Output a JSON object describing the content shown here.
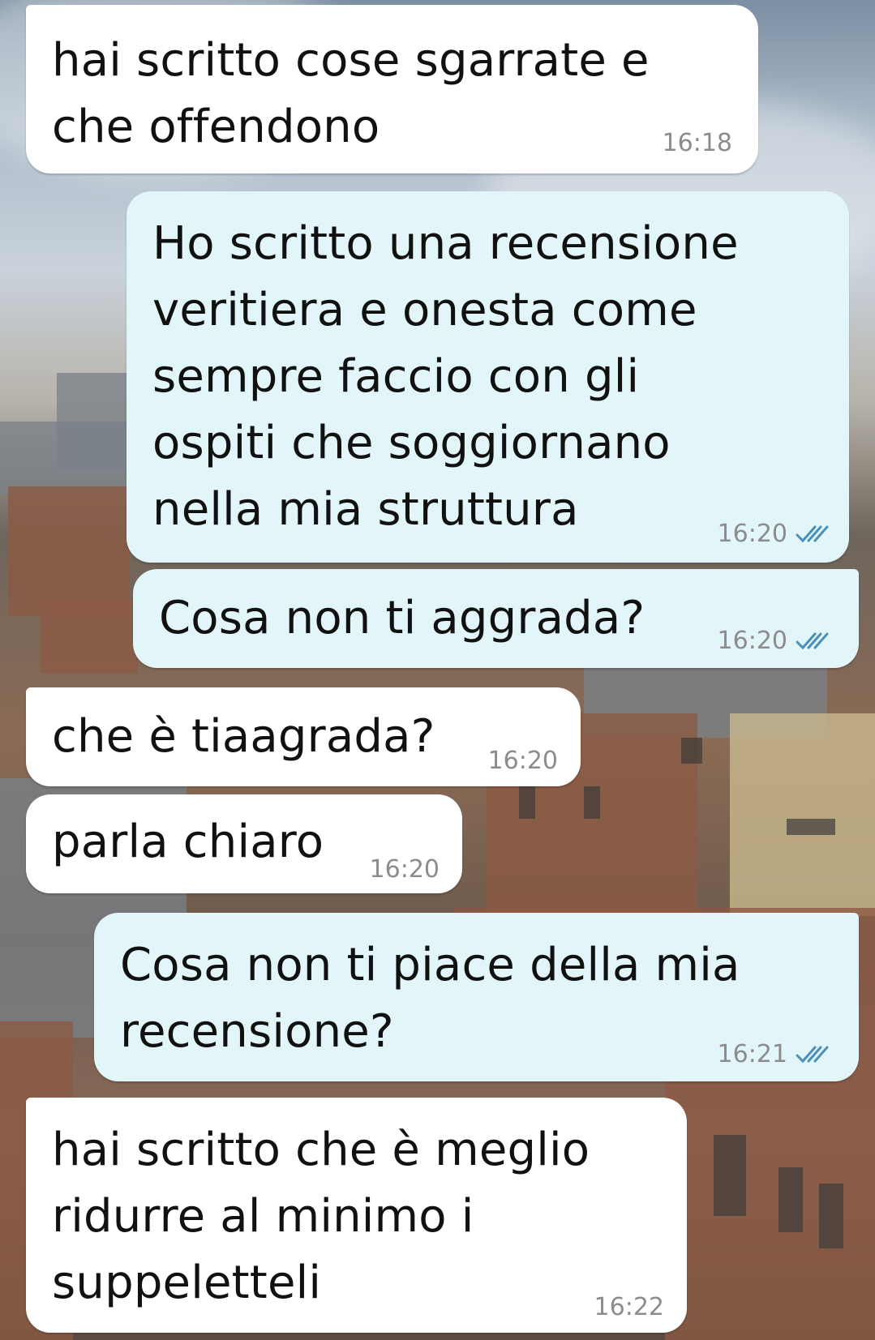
{
  "chat": {
    "messages": [
      {
        "direction": "in",
        "text": "hai scritto cose sgarrate e\nche offendono",
        "time": "16:18"
      },
      {
        "direction": "out",
        "text": "Ho scritto una recensione\nveritiera e onesta come\nsempre faccio con gli\nospiti che soggiornano\nnella mia struttura",
        "time": "16:20",
        "status_icon": "double-check-icon"
      },
      {
        "direction": "out",
        "text": "Cosa non ti aggrada?",
        "time": "16:20",
        "status_icon": "double-check-icon"
      },
      {
        "direction": "in",
        "text": "che è tiaagrada?",
        "time": "16:20"
      },
      {
        "direction": "in",
        "text": "parla chiaro",
        "time": "16:20"
      },
      {
        "direction": "out",
        "text": "Cosa non ti piace della mia\nrecensione?",
        "time": "16:21",
        "status_icon": "double-check-icon"
      },
      {
        "direction": "in",
        "text": "hai scritto che è meglio\nridurre al minimo i\nsuppeletteli",
        "time": "16:22"
      }
    ]
  },
  "colors": {
    "incoming_bubble": "#ffffff",
    "outgoing_bubble": "#e2f6f9",
    "timestamp": "#8c8c8c",
    "read_ticks": "#4a90b8"
  }
}
